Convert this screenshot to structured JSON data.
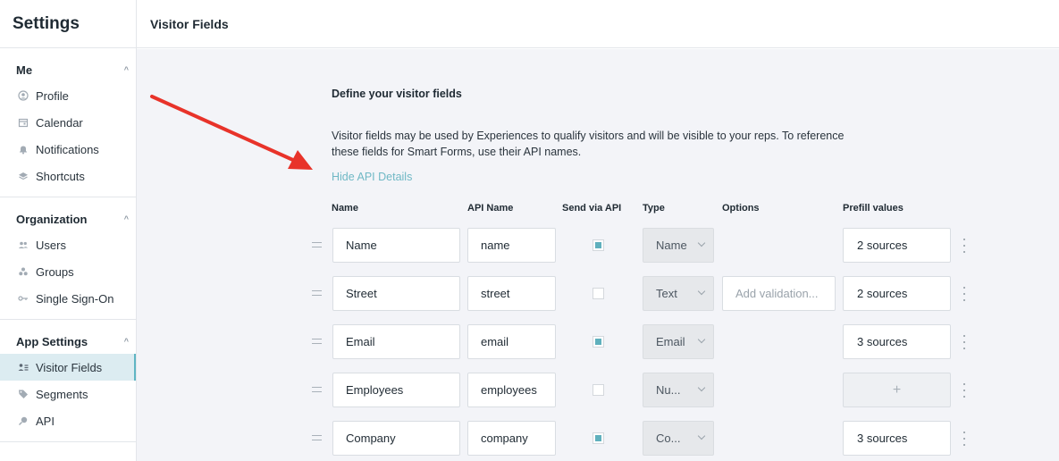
{
  "sidebar": {
    "title": "Settings",
    "groups": [
      {
        "label": "Me",
        "items": [
          {
            "label": "Profile",
            "icon": "user-circle-icon"
          },
          {
            "label": "Calendar",
            "icon": "calendar-icon"
          },
          {
            "label": "Notifications",
            "icon": "bell-icon"
          },
          {
            "label": "Shortcuts",
            "icon": "layers-icon"
          }
        ]
      },
      {
        "label": "Organization",
        "items": [
          {
            "label": "Users",
            "icon": "users-icon"
          },
          {
            "label": "Groups",
            "icon": "groups-icon"
          },
          {
            "label": "Single Sign-On",
            "icon": "key-icon"
          }
        ]
      },
      {
        "label": "App Settings",
        "items": [
          {
            "label": "Visitor Fields",
            "icon": "user-list-icon",
            "active": true
          },
          {
            "label": "Segments",
            "icon": "tag-icon"
          },
          {
            "label": "API",
            "icon": "plug-icon"
          }
        ]
      }
    ]
  },
  "header": {
    "title": "Visitor Fields"
  },
  "main": {
    "section_title": "Define your visitor fields",
    "description": "Visitor fields may be used by Experiences to qualify visitors and will be visible to your reps. To reference these fields for Smart Forms, use their API names.",
    "hide_link": "Hide API Details",
    "columns": {
      "name": "Name",
      "api_name": "API Name",
      "send_via_api": "Send via API",
      "type": "Type",
      "options": "Options",
      "prefill": "Prefill values"
    },
    "rows": [
      {
        "name": "Name",
        "api_name": "name",
        "send_via_api": true,
        "type": "Name",
        "options": null,
        "prefill": "2 sources"
      },
      {
        "name": "Street",
        "api_name": "street",
        "send_via_api": false,
        "type": "Text",
        "options": "Add validation...",
        "prefill": "2 sources"
      },
      {
        "name": "Email",
        "api_name": "email",
        "send_via_api": true,
        "type": "Email",
        "options": null,
        "prefill": "3 sources"
      },
      {
        "name": "Employees",
        "api_name": "employees",
        "send_via_api": false,
        "type": "Nu...",
        "options": null,
        "prefill": "+"
      },
      {
        "name": "Company",
        "api_name": "company",
        "send_via_api": true,
        "type": "Co...",
        "options": null,
        "prefill": "3 sources"
      }
    ]
  },
  "colors": {
    "accent": "#5fb0bd",
    "link": "#6fb8c5",
    "arrow": "#e8332a",
    "active_nav_bg": "#dcecf1"
  }
}
